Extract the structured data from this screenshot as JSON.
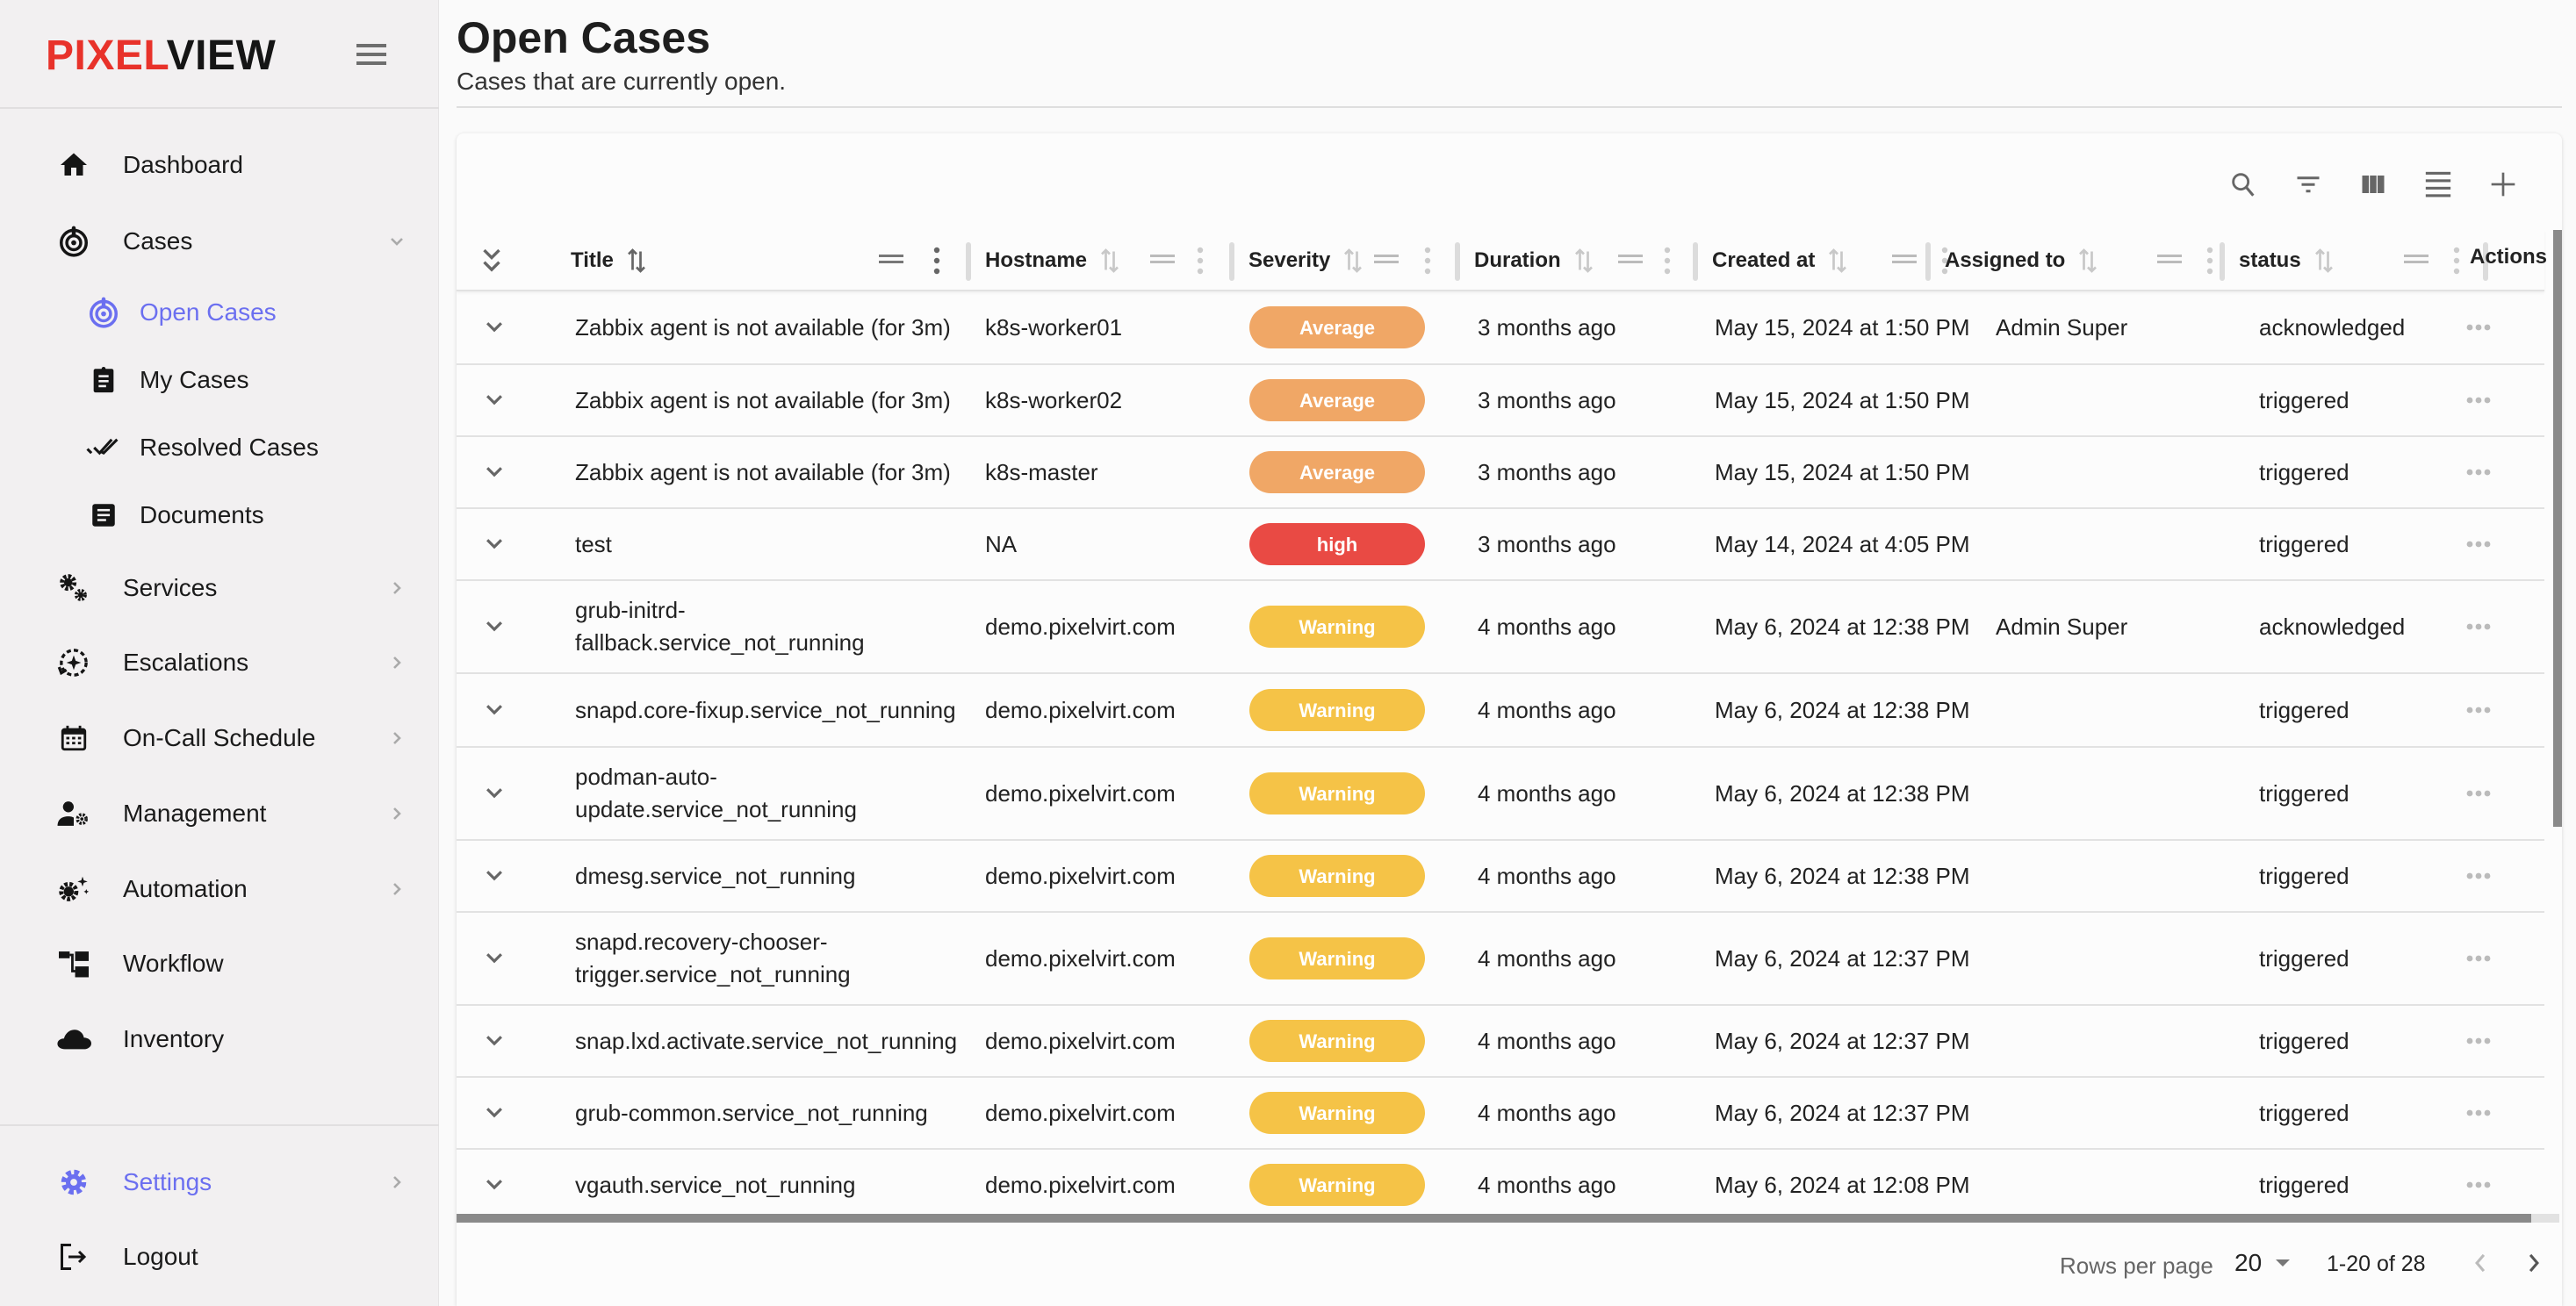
{
  "app": {
    "logo_part1": "PIXEL",
    "logo_part2": "VIEW",
    "accent_color": "#6b6ff0",
    "brand_red": "#e8322a"
  },
  "sidebar": {
    "items": [
      {
        "label": "Dashboard",
        "icon": "home-icon"
      },
      {
        "label": "Cases",
        "icon": "target-alert-icon",
        "expanded": true
      },
      {
        "label": "Open Cases",
        "icon": "target-alert-icon",
        "active": true,
        "sub": true
      },
      {
        "label": "My Cases",
        "icon": "clipboard-icon",
        "sub": true
      },
      {
        "label": "Resolved Cases",
        "icon": "double-check-icon",
        "sub": true
      },
      {
        "label": "Documents",
        "icon": "document-icon",
        "sub": true
      },
      {
        "label": "Services",
        "icon": "gears-icon"
      },
      {
        "label": "Escalations",
        "icon": "escalation-icon"
      },
      {
        "label": "On-Call Schedule",
        "icon": "calendar-icon"
      },
      {
        "label": "Management",
        "icon": "user-gear-icon"
      },
      {
        "label": "Automation",
        "icon": "gear-sparkle-icon"
      },
      {
        "label": "Workflow",
        "icon": "workflow-icon"
      },
      {
        "label": "Inventory",
        "icon": "cloud-icon"
      }
    ],
    "bottom": [
      {
        "label": "Settings",
        "icon": "settings-icon",
        "active": true
      },
      {
        "label": "Logout",
        "icon": "logout-icon"
      }
    ]
  },
  "page": {
    "title": "Open Cases",
    "subtitle": "Cases that are currently open."
  },
  "toolbar": {
    "icons": [
      "search-icon",
      "filter-icon",
      "columns-icon",
      "density-icon",
      "add-icon"
    ]
  },
  "table": {
    "columns": [
      "Title",
      "Hostname",
      "Severity",
      "Duration",
      "Created at",
      "Assigned to",
      "status",
      "Actions"
    ],
    "severity_colors": {
      "Average": "#f0a766",
      "high": "#e94a44",
      "Warning": "#f5c347"
    },
    "rows": [
      {
        "title": "Zabbix agent is not available (for 3m)",
        "hostname": "k8s-worker01",
        "severity": "Average",
        "duration": "3 months ago",
        "created": "May 15, 2024 at 1:50 PM",
        "assigned": "Admin Super",
        "status": "acknowledged"
      },
      {
        "title": "Zabbix agent is not available (for 3m)",
        "hostname": "k8s-worker02",
        "severity": "Average",
        "duration": "3 months ago",
        "created": "May 15, 2024 at 1:50 PM",
        "assigned": "",
        "status": "triggered"
      },
      {
        "title": "Zabbix agent is not available (for 3m)",
        "hostname": "k8s-master",
        "severity": "Average",
        "duration": "3 months ago",
        "created": "May 15, 2024 at 1:50 PM",
        "assigned": "",
        "status": "triggered"
      },
      {
        "title": "test",
        "hostname": "NA",
        "severity": "high",
        "duration": "3 months ago",
        "created": "May 14, 2024 at 4:05 PM",
        "assigned": "",
        "status": "triggered"
      },
      {
        "title": "grub-initrd-fallback.service_not_running",
        "title_lines": [
          "grub-initrd-",
          "fallback.service_not_running"
        ],
        "hostname": "demo.pixelvirt.com",
        "severity": "Warning",
        "duration": "4 months ago",
        "created": "May 6, 2024 at 12:38 PM",
        "assigned": "Admin Super",
        "status": "acknowledged"
      },
      {
        "title": "snapd.core-fixup.service_not_running",
        "hostname": "demo.pixelvirt.com",
        "severity": "Warning",
        "duration": "4 months ago",
        "created": "May 6, 2024 at 12:38 PM",
        "assigned": "",
        "status": "triggered"
      },
      {
        "title": "podman-auto-update.service_not_running",
        "title_lines": [
          "podman-auto-",
          "update.service_not_running"
        ],
        "hostname": "demo.pixelvirt.com",
        "severity": "Warning",
        "duration": "4 months ago",
        "created": "May 6, 2024 at 12:38 PM",
        "assigned": "",
        "status": "triggered"
      },
      {
        "title": "dmesg.service_not_running",
        "hostname": "demo.pixelvirt.com",
        "severity": "Warning",
        "duration": "4 months ago",
        "created": "May 6, 2024 at 12:38 PM",
        "assigned": "",
        "status": "triggered"
      },
      {
        "title": "snapd.recovery-chooser-trigger.service_not_running",
        "title_lines": [
          "snapd.recovery-chooser-",
          "trigger.service_not_running"
        ],
        "hostname": "demo.pixelvirt.com",
        "severity": "Warning",
        "duration": "4 months ago",
        "created": "May 6, 2024 at 12:37 PM",
        "assigned": "",
        "status": "triggered"
      },
      {
        "title": "snap.lxd.activate.service_not_running",
        "hostname": "demo.pixelvirt.com",
        "severity": "Warning",
        "duration": "4 months ago",
        "created": "May 6, 2024 at 12:37 PM",
        "assigned": "",
        "status": "triggered"
      },
      {
        "title": "grub-common.service_not_running",
        "hostname": "demo.pixelvirt.com",
        "severity": "Warning",
        "duration": "4 months ago",
        "created": "May 6, 2024 at 12:37 PM",
        "assigned": "",
        "status": "triggered"
      },
      {
        "title": "vgauth.service_not_running",
        "hostname": "demo.pixelvirt.com",
        "severity": "Warning",
        "duration": "4 months ago",
        "created": "May 6, 2024 at 12:08 PM",
        "assigned": "",
        "status": "triggered"
      }
    ]
  },
  "pagination": {
    "rows_per_page_label": "Rows per page",
    "rows_per_page": "20",
    "range": "1-20 of 28"
  }
}
